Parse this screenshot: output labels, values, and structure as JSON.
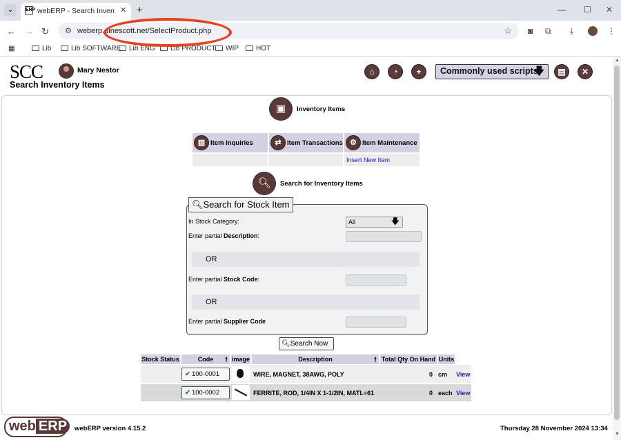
{
  "browser": {
    "tab_title": "webERP - Search Inventory Items",
    "favicon": "ERP",
    "url": "weberp.dinescott.net/SelectProduct.php",
    "bookmarks": [
      "Lib",
      "Lib SOFTWARE",
      "Lib ENG",
      "Lib PRODUCT",
      "WIP",
      "HOT"
    ]
  },
  "header": {
    "logo": "SCC",
    "user_name": "Mary Nestor",
    "page_title": "Search Inventory Items",
    "scripts_button": "Commonly used scripts"
  },
  "module": {
    "title": "Inventory Items",
    "menus": [
      {
        "label": "Item Inquiries",
        "icon": "chart-icon"
      },
      {
        "label": "Item Transactions",
        "icon": "transfer-icon"
      },
      {
        "label": "Item Maintenance",
        "icon": "gear-icon"
      }
    ],
    "maintenance_link": "Insert New Item"
  },
  "search": {
    "section_title": "Search for Inventory Items",
    "legend": "Search for Stock Item",
    "category_label": "In Stock Category:",
    "category_value": "All",
    "desc_label_prefix": "Enter partial ",
    "desc_label_bold": "Description",
    "desc_label_suffix": ":",
    "or1": "OR",
    "code_label_prefix": "Enter partial ",
    "code_label_bold": "Stock Code",
    "code_label_suffix": ":",
    "or2": "OR",
    "supplier_label_prefix": "Enter partial ",
    "supplier_label_bold": "Supplier Code",
    "button": "Search Now"
  },
  "results": {
    "headers": [
      "Stock Status",
      "Code",
      "image",
      "Description",
      "Total Qty On Hand",
      "Units"
    ],
    "rows": [
      {
        "code": "100-0001",
        "description": "WIRE, MAGNET, 38AWG, POLY",
        "qty": "0",
        "units": "cm",
        "link": "View"
      },
      {
        "code": "100-0002",
        "description": "FERRITE, ROD, 1/4IN X 1-1/2IN, MATL=61",
        "qty": "0",
        "units": "each",
        "link": "View"
      }
    ]
  },
  "footer": {
    "logo_web": "web",
    "logo_erp": "ERP",
    "version": "webERP version 4.15.2",
    "datetime": "Thursday 28 November 2024 13:34"
  }
}
